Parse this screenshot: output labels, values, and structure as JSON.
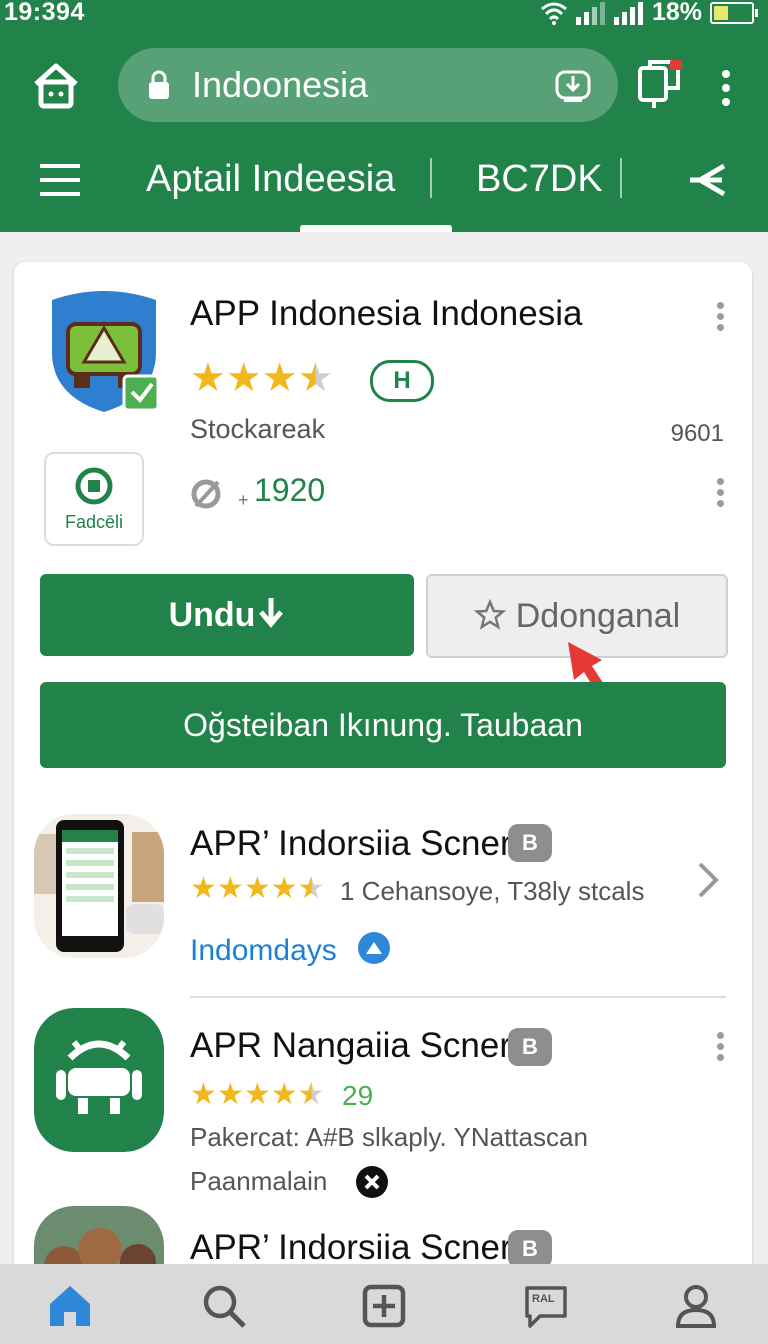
{
  "status_bar": {
    "time": "19:394",
    "battery": "18%"
  },
  "address_bar": {
    "url": "Indoonesia"
  },
  "nav": {
    "title": "Aptail Indeesia",
    "tab": "BC7DK"
  },
  "app": {
    "title": "APP Indonesia Indonesia",
    "rating": 3.5,
    "pill_badge": "H",
    "developer": "Stockareak",
    "size": "9601",
    "badge_label": "Fadcēli",
    "downloads_prefix": "+",
    "downloads": "1920",
    "download_button": "Undu",
    "wishlist_button": "Ddonganal",
    "wide_button": "Oğsteiban Ikınung. Taubaan"
  },
  "list": [
    {
      "title": "APR’ Indorsiia Scner",
      "badge": "B",
      "rating": 4.5,
      "meta": "1 Cehansoye, T38ly stcals",
      "link": "Indomdays"
    },
    {
      "title": "APR Nangaiia Scner",
      "badge": "B",
      "rating": 4.5,
      "meta": "29",
      "desc": "Pakercat: A#B slkaply. YNattascan",
      "sub": "Paanmalain"
    },
    {
      "title": "APR’ Indorsiia Scner",
      "badge": "B"
    }
  ],
  "bottom_nav": [
    "home-icon",
    "search-icon",
    "add-icon",
    "chat-icon",
    "profile-icon"
  ],
  "bottom_nav_chat_label": "RAL",
  "colors": {
    "brand": "#21824a",
    "star": "#f2b81b",
    "link": "#1f7fd6",
    "badge": "#8e8e8e"
  }
}
